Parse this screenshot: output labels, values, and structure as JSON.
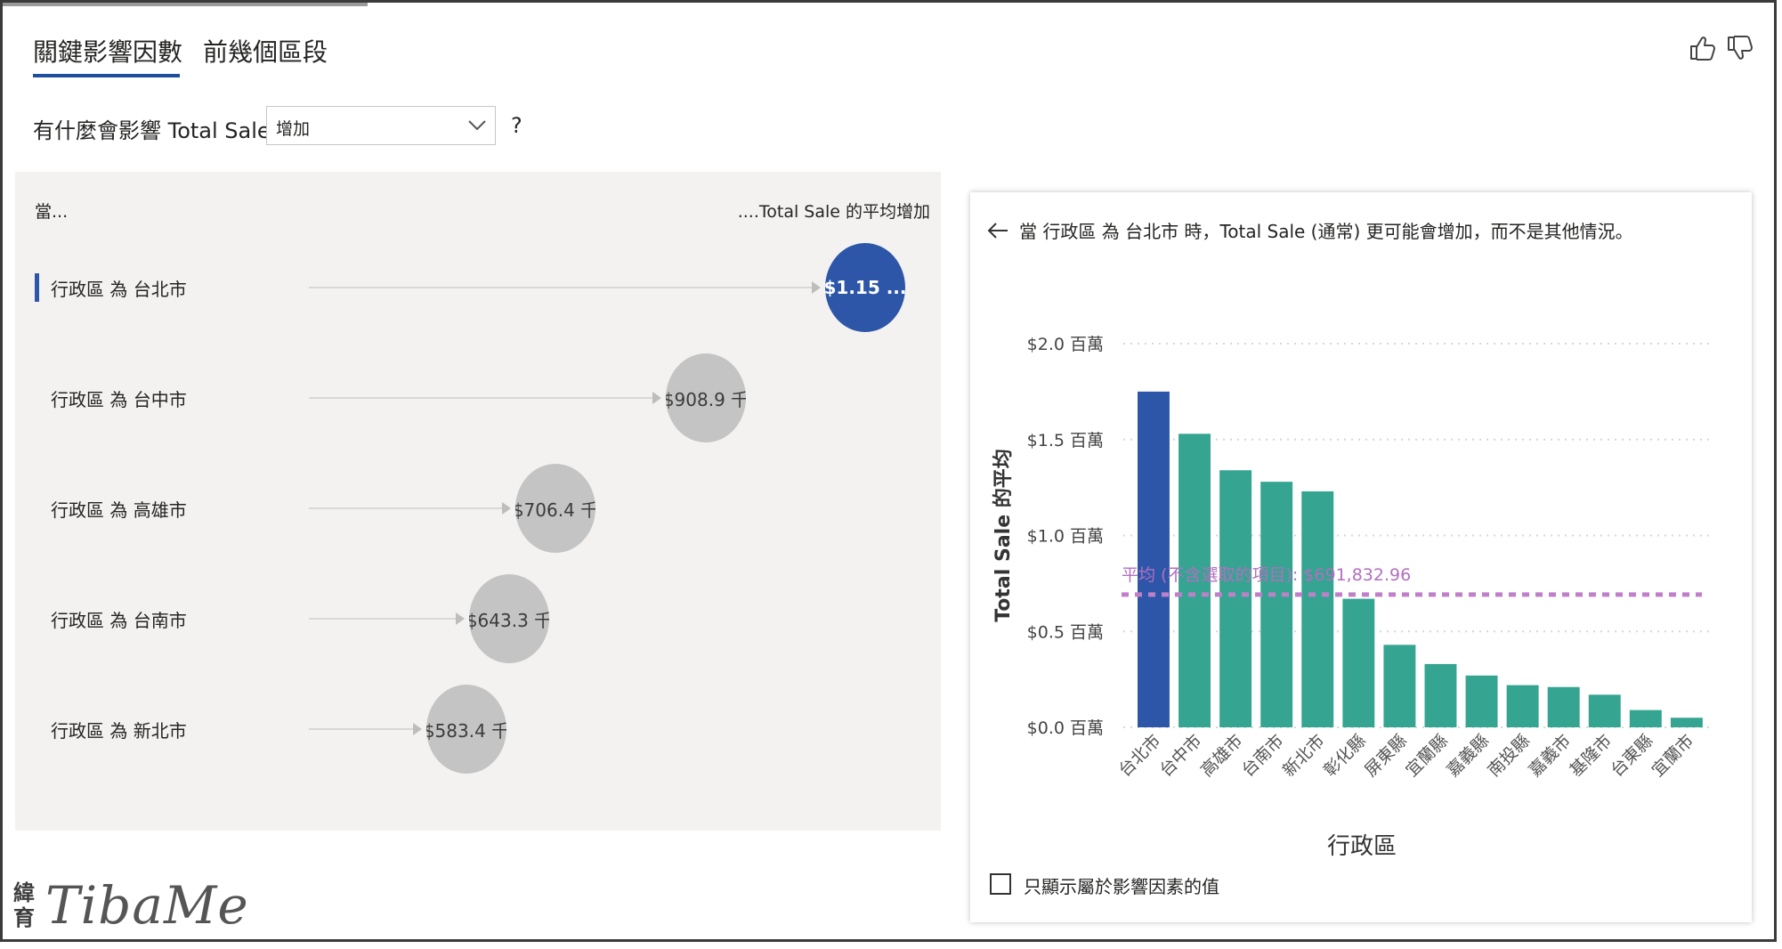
{
  "tabs": [
    {
      "label": "關鍵影響因數",
      "active": true
    },
    {
      "label": "前幾個區段",
      "active": false
    }
  ],
  "question": {
    "prefix": "有什麼會影響 Total Sale",
    "selected": "增加",
    "suffix": "?"
  },
  "left_panel": {
    "col_when": "當...",
    "col_avg": "....Total Sale 的平均增加",
    "rows": [
      {
        "label": "行政區 為 台北市",
        "value_label": "$1.15 ...",
        "selected": true
      },
      {
        "label": "行政區 為 台中市",
        "value_label": "$908.9 千",
        "selected": false
      },
      {
        "label": "行政區 為 高雄市",
        "value_label": "$706.4 千",
        "selected": false
      },
      {
        "label": "行政區 為 台南市",
        "value_label": "$643.3 千",
        "selected": false
      },
      {
        "label": "行政區 為 新北市",
        "value_label": "$583.4 千",
        "selected": false
      }
    ]
  },
  "right_card": {
    "headline": "當 行政區 為 台北市 時，Total Sale (通常) 更可能會增加，而不是其他情況。",
    "checkbox_label": "只顯示屬於影響因素的值"
  },
  "watermark": {
    "cjk": "緯育",
    "text": "TibaMe"
  },
  "colors": {
    "selected": "#2e56a8",
    "bar": "#35a491",
    "avg_line": "#c07fc9",
    "bubble_gray": "#c4c4c4"
  },
  "icons": [
    "thumbs-up-icon",
    "thumbs-down-icon",
    "chevron-down-icon",
    "back-arrow-icon",
    "checkbox-icon"
  ],
  "chart_data": {
    "type": "bar",
    "xlabel": "行政區",
    "ylabel": "Total Sale 的平均",
    "categories": [
      "台北市",
      "台中市",
      "高雄市",
      "台南市",
      "新北市",
      "彰化縣",
      "屏東縣",
      "宜蘭縣",
      "嘉義縣",
      "南投縣",
      "嘉義市",
      "基隆市",
      "台東縣",
      "宜蘭市"
    ],
    "values": [
      1.75,
      1.53,
      1.34,
      1.28,
      1.23,
      0.67,
      0.43,
      0.33,
      0.27,
      0.22,
      0.21,
      0.17,
      0.09,
      0.05
    ],
    "unit": "百萬",
    "yticks": [
      "$0.0 百萬",
      "$0.5 百萬",
      "$1.0 百萬",
      "$1.5 百萬",
      "$2.0 百萬"
    ],
    "ylim": [
      0,
      2.0
    ],
    "highlight_index": 0,
    "reference_line": {
      "value": 0.691833,
      "label": "平均 (不含選取的項目): $691,832.96"
    },
    "grid": true
  }
}
